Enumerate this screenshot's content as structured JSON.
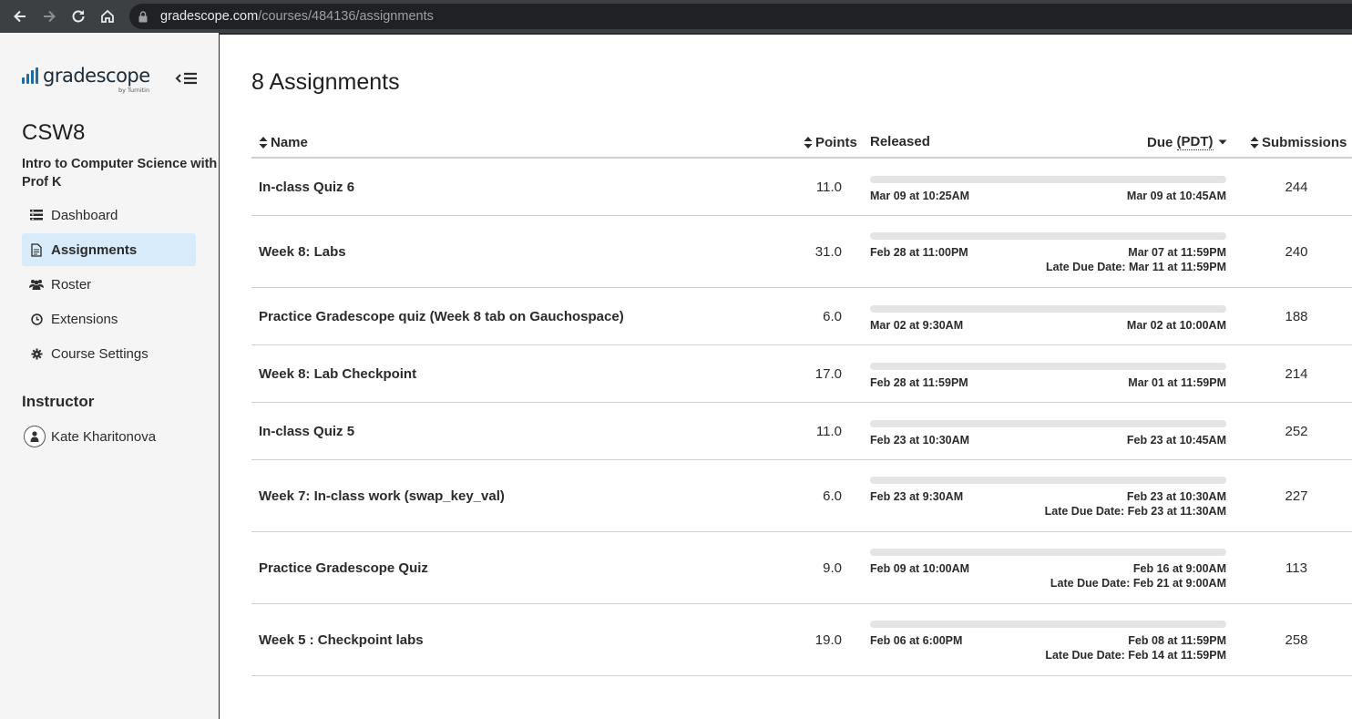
{
  "browser": {
    "url_host": "gradescope.com",
    "url_path": "/courses/484136/assignments"
  },
  "sidebar": {
    "logo_text": "gradescope",
    "logo_sub": "by Turnitin",
    "course_code": "CSW8",
    "course_name": "Intro to Computer Science with Prof K",
    "nav": [
      {
        "label": "Dashboard",
        "icon": "dashboard-icon"
      },
      {
        "label": "Assignments",
        "icon": "document-icon"
      },
      {
        "label": "Roster",
        "icon": "users-icon"
      },
      {
        "label": "Extensions",
        "icon": "clock-icon"
      },
      {
        "label": "Course Settings",
        "icon": "gear-icon"
      }
    ],
    "instructor_heading": "Instructor",
    "instructor_name": "Kate Kharitonova"
  },
  "main": {
    "title": "8 Assignments",
    "columns": {
      "name": "Name",
      "points": "Points",
      "released": "Released",
      "due": "Due",
      "due_tz": "(PDT)",
      "submissions": "Submissions"
    },
    "assignments": [
      {
        "name": "In-class Quiz 6",
        "points": "11.0",
        "released": "Mar 09 at 10:25AM",
        "due": "Mar 09 at 10:45AM",
        "late_due": "",
        "submissions": "244"
      },
      {
        "name": "Week 8: Labs",
        "points": "31.0",
        "released": "Feb 28 at 11:00PM",
        "due": "Mar 07 at 11:59PM",
        "late_due": "Late Due Date: Mar 11 at 11:59PM",
        "submissions": "240"
      },
      {
        "name": "Practice Gradescope quiz (Week 8 tab on Gauchospace)",
        "points": "6.0",
        "released": "Mar 02 at 9:30AM",
        "due": "Mar 02 at 10:00AM",
        "late_due": "",
        "submissions": "188"
      },
      {
        "name": "Week 8: Lab Checkpoint",
        "points": "17.0",
        "released": "Feb 28 at 11:59PM",
        "due": "Mar 01 at 11:59PM",
        "late_due": "",
        "submissions": "214"
      },
      {
        "name": "In-class Quiz 5",
        "points": "11.0",
        "released": "Feb 23 at 10:30AM",
        "due": "Feb 23 at 10:45AM",
        "late_due": "",
        "submissions": "252"
      },
      {
        "name": "Week 7: In-class work (swap_key_val)",
        "points": "6.0",
        "released": "Feb 23 at 9:30AM",
        "due": "Feb 23 at 10:30AM",
        "late_due": "Late Due Date: Feb 23 at 11:30AM",
        "submissions": "227"
      },
      {
        "name": "Practice Gradescope Quiz",
        "points": "9.0",
        "released": "Feb 09 at 10:00AM",
        "due": "Feb 16 at 9:00AM",
        "late_due": "Late Due Date: Feb 21 at 9:00AM",
        "submissions": "113"
      },
      {
        "name": "Week 5 : Checkpoint labs",
        "points": "19.0",
        "released": "Feb 06 at 6:00PM",
        "due": "Feb 08 at 11:59PM",
        "late_due": "Late Due Date: Feb 14 at 11:59PM",
        "submissions": "258"
      }
    ]
  }
}
